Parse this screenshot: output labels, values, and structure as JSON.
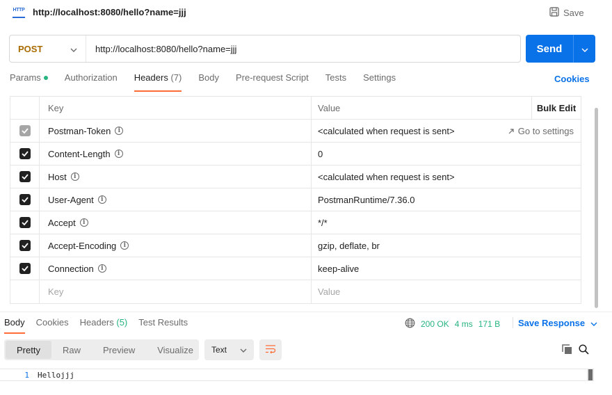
{
  "title": {
    "icon": "HTTP",
    "url": "http://localhost:8080/hello?name=jjj",
    "save_label": "Save"
  },
  "request": {
    "method": "POST",
    "url": "http://localhost:8080/hello?name=jjj",
    "send_label": "Send"
  },
  "req_tabs": {
    "params": "Params",
    "authorization": "Authorization",
    "headers": "Headers",
    "headers_count": "(7)",
    "body": "Body",
    "prerequest": "Pre-request Script",
    "tests": "Tests",
    "settings": "Settings",
    "cookies": "Cookies"
  },
  "headers_table": {
    "col_key": "Key",
    "col_value": "Value",
    "bulk_edit": "Bulk Edit",
    "go_to_settings": "Go to settings",
    "rows": [
      {
        "key": "Postman-Token",
        "value": "<calculated when request is sent>"
      },
      {
        "key": "Content-Length",
        "value": "0"
      },
      {
        "key": "Host",
        "value": "<calculated when request is sent>"
      },
      {
        "key": "User-Agent",
        "value": "PostmanRuntime/7.36.0"
      },
      {
        "key": "Accept",
        "value": "*/*"
      },
      {
        "key": "Accept-Encoding",
        "value": "gzip, deflate, br"
      },
      {
        "key": "Connection",
        "value": "keep-alive"
      }
    ],
    "key_placeholder": "Key",
    "value_placeholder": "Value"
  },
  "response": {
    "tabs": {
      "body": "Body",
      "cookies": "Cookies",
      "headers": "Headers",
      "headers_count": "(5)",
      "test_results": "Test Results"
    },
    "status": "200 OK",
    "time": "4 ms",
    "size": "171 B",
    "save_response": "Save Response",
    "views": {
      "pretty": "Pretty",
      "raw": "Raw",
      "preview": "Preview",
      "visualize": "Visualize"
    },
    "format": "Text",
    "line_number": "1",
    "body_text": "Hellojjj"
  },
  "colors": {
    "accent": "#ff6c37",
    "primary": "#0a72e8",
    "success": "#26b47f",
    "method": "#a86b00"
  }
}
